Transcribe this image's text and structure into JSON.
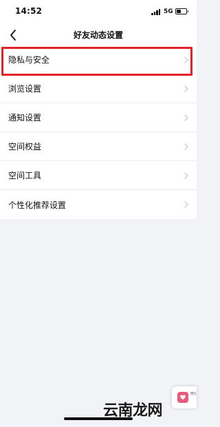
{
  "status_bar": {
    "time": "14:52",
    "network": "5G",
    "signal_icon": "signal-bars-icon",
    "battery_icon": "battery-icon"
  },
  "nav": {
    "title": "好友动态设置",
    "back_icon": "chevron-left-icon"
  },
  "settings": {
    "items": [
      {
        "label": "隐私与安全",
        "highlighted": true
      },
      {
        "label": "浏览设置"
      },
      {
        "label": "通知设置"
      },
      {
        "label": "空间权益"
      },
      {
        "label": "空间工具"
      },
      {
        "label": "个性化推荐设置"
      }
    ]
  },
  "highlight_color": "#e2232a",
  "floating_widget": {
    "icon": "app-shortcut-icon",
    "text": "微信 群动"
  },
  "watermark": {
    "text": "云南龙网"
  },
  "colors": {
    "page_background": "#f2f3f7",
    "list_background": "#ffffff"
  }
}
